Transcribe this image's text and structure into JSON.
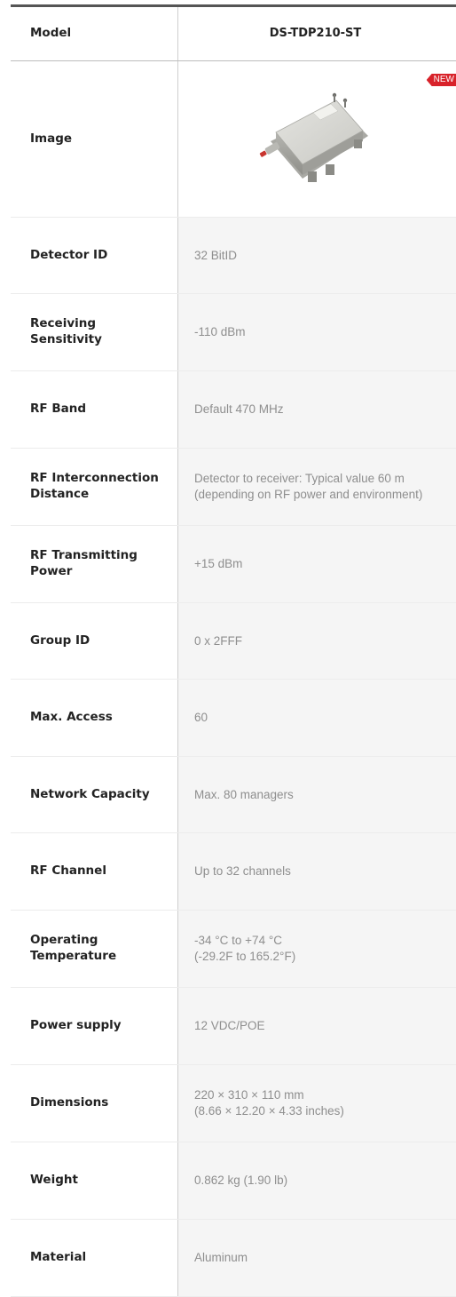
{
  "table": {
    "header": {
      "label": "Model",
      "value": "DS-TDP210-ST"
    },
    "image_row": {
      "label": "Image",
      "badge": "NEW",
      "image_icon": "receiver-device-icon"
    },
    "rows": [
      {
        "label": "Detector ID",
        "value": "32 BitID"
      },
      {
        "label": "Receiving Sensitivity",
        "value": "-110 dBm"
      },
      {
        "label": "RF Band",
        "value": "Default 470 MHz"
      },
      {
        "label": "RF Interconnection Distance",
        "value": "Detector to receiver: Typical value 60 m\n(depending on RF power and environment)"
      },
      {
        "label": "RF Transmitting Power",
        "value": "+15 dBm"
      },
      {
        "label": "Group ID",
        "value": "0 x 2FFF"
      },
      {
        "label": "Max. Access",
        "value": "60"
      },
      {
        "label": "Network Capacity",
        "value": "Max. 80 managers"
      },
      {
        "label": "RF Channel",
        "value": "Up to 32 channels"
      },
      {
        "label": "Operating Temperature",
        "value": "-34 °C to +74 °C\n(-29.2F to 165.2°F)"
      },
      {
        "label": "Power supply",
        "value": "12 VDC/POE"
      },
      {
        "label": "Dimensions",
        "value": "220 × 310 × 110 mm\n(8.66 × 12.20 × 4.33 inches)"
      },
      {
        "label": "Weight",
        "value": "0.862 kg (1.90 lb)"
      },
      {
        "label": "Material",
        "value": "Aluminum"
      }
    ]
  },
  "colors": {
    "label_text": "#222222",
    "value_text": "#8e8e8e",
    "shaded_bg": "#f5f5f5",
    "badge_bg": "#d8222a"
  }
}
